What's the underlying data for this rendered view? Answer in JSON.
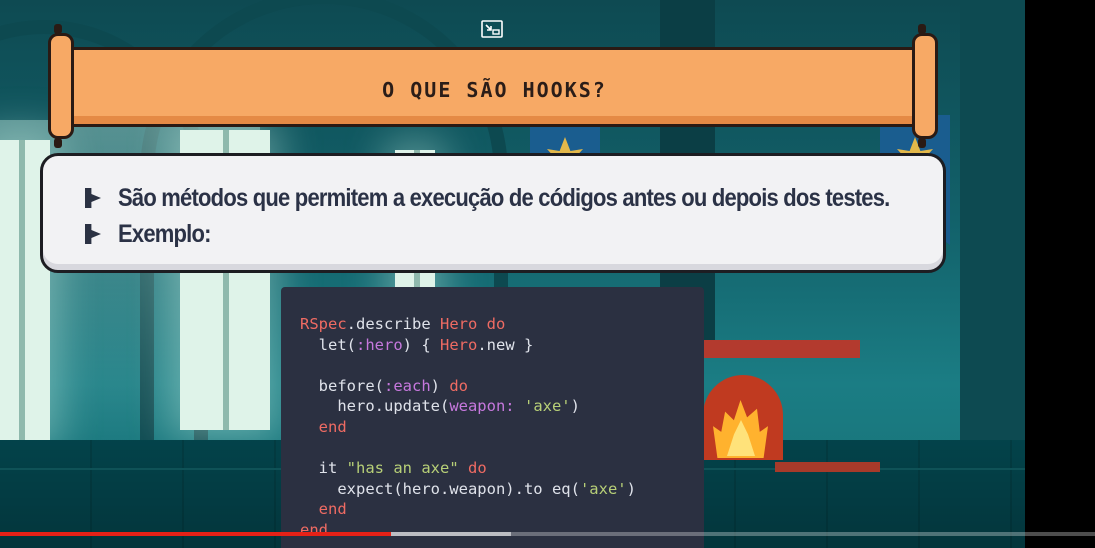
{
  "slide": {
    "title": "O QUE SÃO HOOKS?",
    "bullets": [
      "São métodos que permitem a execução de códigos antes ou depois dos testes.",
      "Exemplo:"
    ]
  },
  "code": {
    "lines": [
      [
        {
          "t": "RSpec",
          "c": "red"
        },
        {
          "t": ".describe ",
          "c": "white"
        },
        {
          "t": "Hero",
          "c": "red"
        },
        {
          "t": " do",
          "c": "red"
        }
      ],
      [
        {
          "t": "  let(",
          "c": "white"
        },
        {
          "t": ":hero",
          "c": "purple"
        },
        {
          "t": ") { ",
          "c": "white"
        },
        {
          "t": "Hero",
          "c": "red"
        },
        {
          "t": ".new }",
          "c": "white"
        }
      ],
      [],
      [
        {
          "t": "  before(",
          "c": "white"
        },
        {
          "t": ":each",
          "c": "purple"
        },
        {
          "t": ") ",
          "c": "white"
        },
        {
          "t": "do",
          "c": "red"
        }
      ],
      [
        {
          "t": "    hero.update(",
          "c": "white"
        },
        {
          "t": "weapon:",
          "c": "purple"
        },
        {
          "t": " ",
          "c": "white"
        },
        {
          "t": "'axe'",
          "c": "green"
        },
        {
          "t": ")",
          "c": "white"
        }
      ],
      [
        {
          "t": "  end",
          "c": "red"
        }
      ],
      [],
      [
        {
          "t": "  it ",
          "c": "white"
        },
        {
          "t": "\"has an axe\"",
          "c": "green"
        },
        {
          "t": " do",
          "c": "red"
        }
      ],
      [
        {
          "t": "    expect(hero.weapon).to eq(",
          "c": "white"
        },
        {
          "t": "'axe'",
          "c": "green"
        },
        {
          "t": ")",
          "c": "white"
        }
      ],
      [
        {
          "t": "  end",
          "c": "red"
        }
      ],
      [
        {
          "t": "end",
          "c": "red"
        }
      ]
    ]
  },
  "player": {
    "icons": {
      "exit_fullscreen": "exit-fullscreen-icon"
    },
    "progress_played": 0.357,
    "progress_buffered": 0.467,
    "colors": {
      "played": "#e62117"
    }
  }
}
